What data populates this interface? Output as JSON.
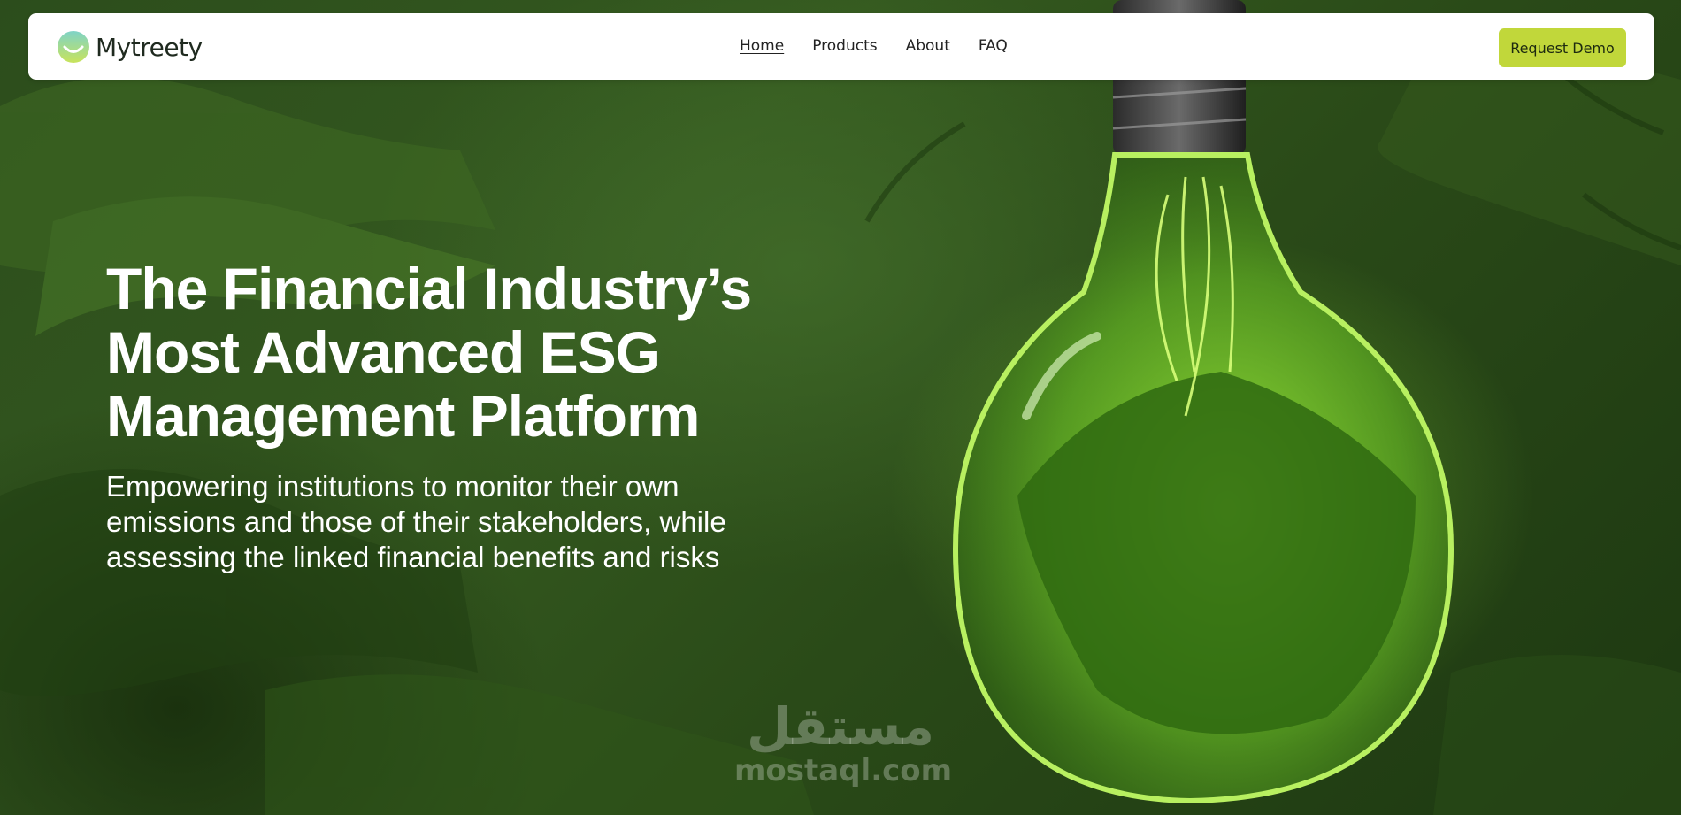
{
  "brand": {
    "name": "Mytreety"
  },
  "nav": {
    "items": [
      {
        "label": "Home",
        "active": true
      },
      {
        "label": "Products",
        "active": false
      },
      {
        "label": "About",
        "active": false
      },
      {
        "label": "FAQ",
        "active": false
      }
    ],
    "cta_label": "Request Demo"
  },
  "hero": {
    "headline_lines": [
      "The Financial Industry’s",
      "Most Advanced ESG",
      "Management Platform"
    ],
    "subhead_lines": [
      "Empowering institutions to monitor their own",
      "emissions and those of their stakeholders, while",
      "assessing the linked financial benefits and risks"
    ]
  },
  "watermark": {
    "arabic": "مستقل",
    "latin": "mostaql.com"
  },
  "colors": {
    "accent": "#c1d73a",
    "background_green": "#2c4d1c",
    "bulb_glow": "#8be02a"
  }
}
